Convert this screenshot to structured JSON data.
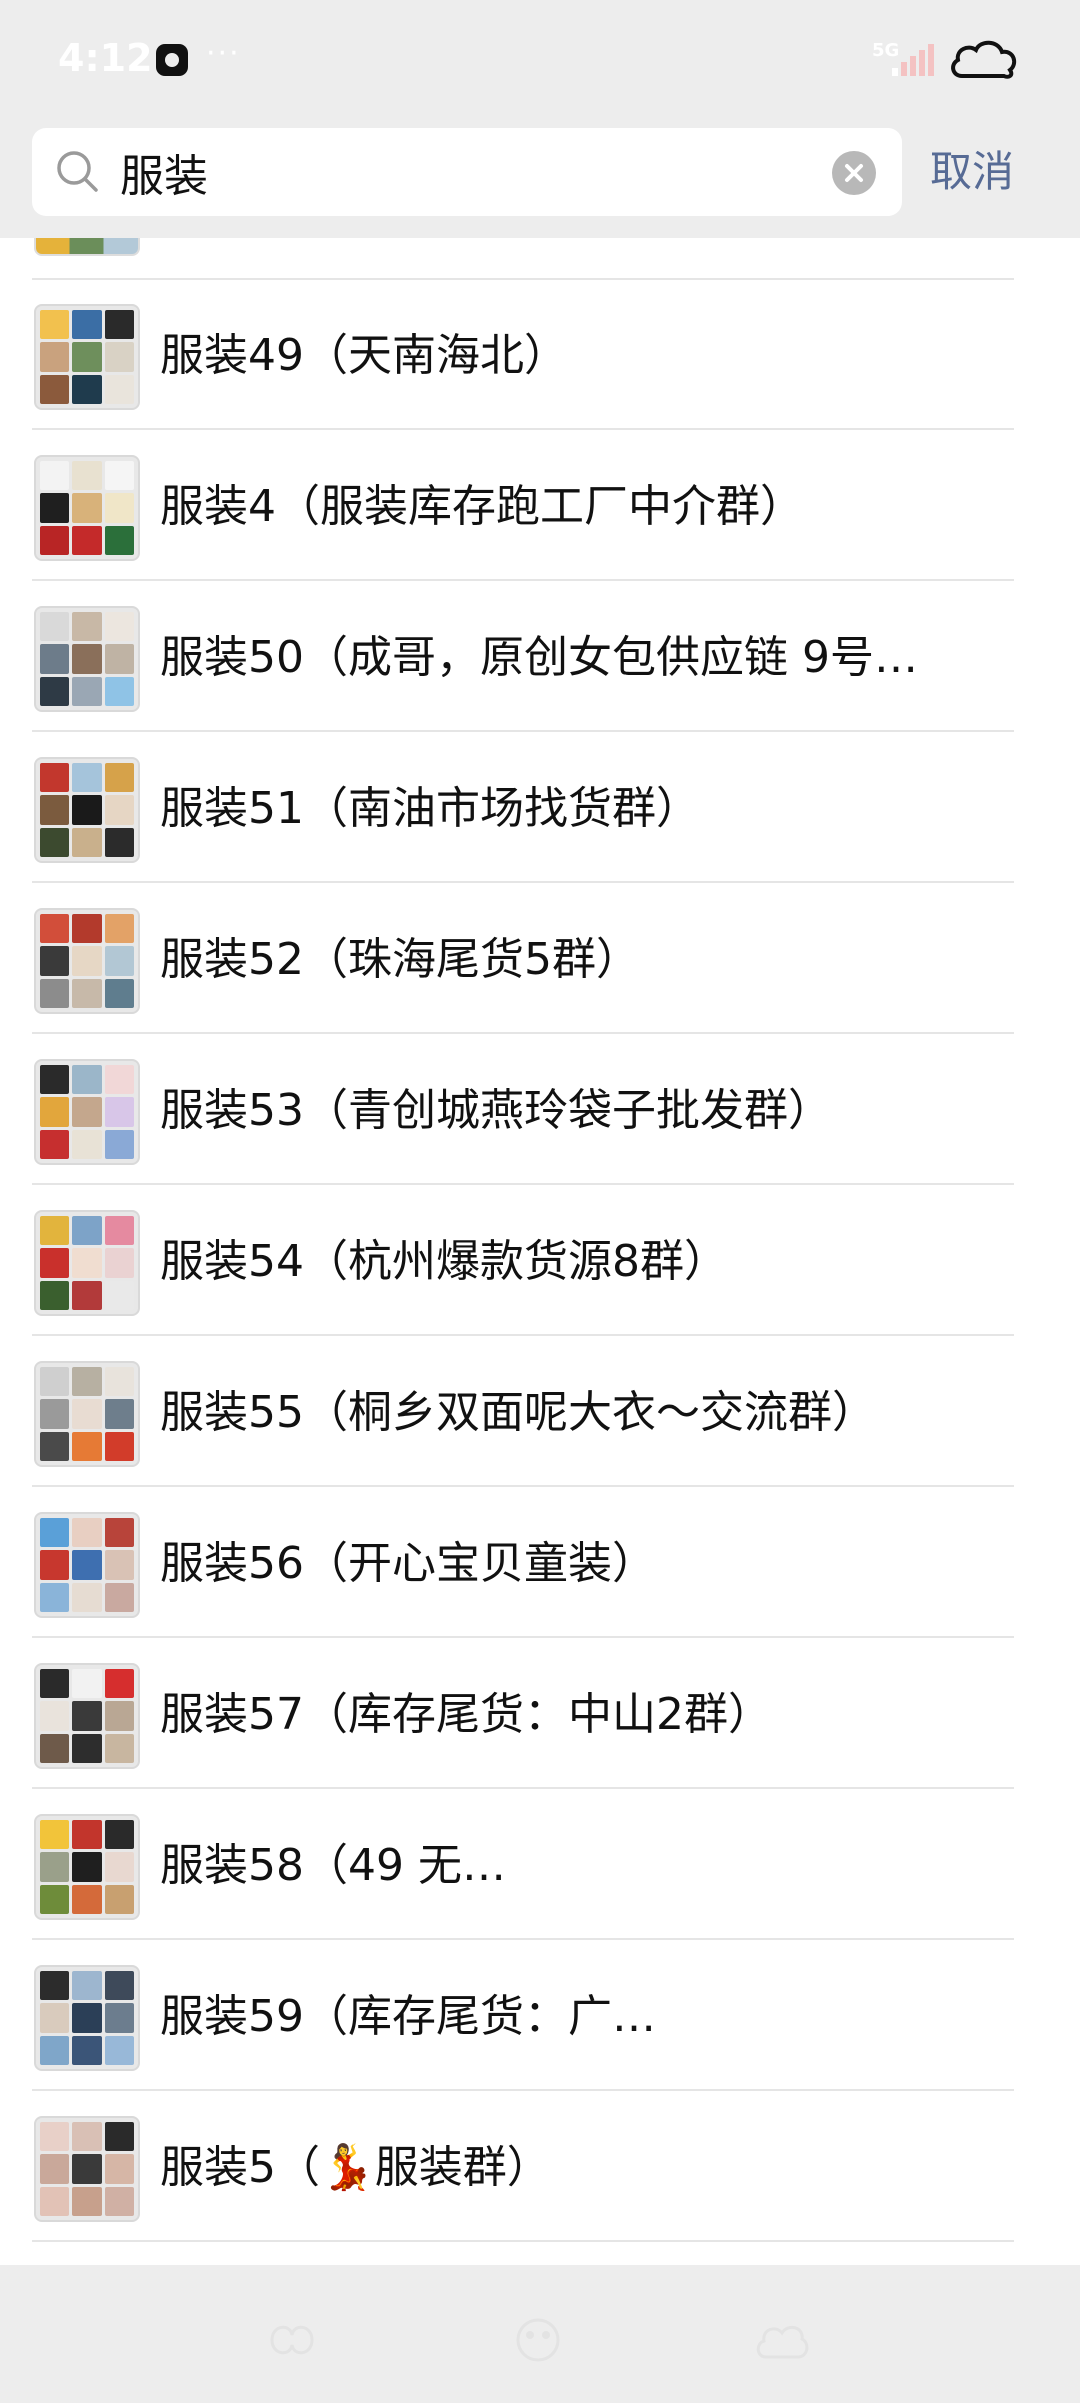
{
  "status_bar": {
    "time": "4:12",
    "dots": "···",
    "network": "5G"
  },
  "search": {
    "query": "服装",
    "cancel_label": "取消"
  },
  "results": [
    {
      "title": "服装49（天南海北）",
      "tiles": [
        "#f2c14e",
        "#3b6ea5",
        "#2a2a2a",
        "#c9a27e",
        "#6e8f5c",
        "#d9d2c5",
        "#8b5a3c",
        "#1f3b4d",
        "#e9e4dc"
      ]
    },
    {
      "title": "服装4（服装库存跑工厂中介群）",
      "tiles": [
        "#f3f3f3",
        "#e8e1d0",
        "#f5f5f5",
        "#1f1f1f",
        "#d8b27a",
        "#f0e6c8",
        "#b82525",
        "#c42a2a",
        "#2b6f3a"
      ]
    },
    {
      "title": "服装50（成哥，原创女包供应链 9号…",
      "tiles": [
        "#d9d9d9",
        "#c8b8a6",
        "#ece6df",
        "#6d7c8a",
        "#8a6f5a",
        "#bfb3a4",
        "#2e3a45",
        "#9aa7b4",
        "#8fc3e6"
      ]
    },
    {
      "title": "服装51（南油市场找货群）",
      "tiles": [
        "#c2372d",
        "#a5c4db",
        "#d6a24a",
        "#7b5b3e",
        "#1a1a1a",
        "#e6d6c4",
        "#3c4a2f",
        "#c9b08c",
        "#2b2b2b"
      ]
    },
    {
      "title": "服装52（珠海尾货5群）",
      "tiles": [
        "#d24e3a",
        "#b33a2c",
        "#e3a267",
        "#3a3a3a",
        "#e6d7c5",
        "#b2c7d4",
        "#8c8c8c",
        "#c7b9a9",
        "#5f7d8e"
      ]
    },
    {
      "title": "服装53（青创城燕玲袋子批发群）",
      "tiles": [
        "#2a2a2a",
        "#9bb6c9",
        "#f1d7d7",
        "#e2a63c",
        "#c4a78d",
        "#d8c6e8",
        "#c62f2f",
        "#e8e2d6",
        "#8aa9d6"
      ]
    },
    {
      "title": "服装54（杭州爆款货源8群）",
      "tiles": [
        "#e2b43d",
        "#7da3c8",
        "#e58aa0",
        "#c9302c",
        "#f0ddd0",
        "#ead2d2",
        "#3a5f2e",
        "#b23a3a",
        "#e9e9e9"
      ]
    },
    {
      "title": "服装55（桐乡双面呢大衣～交流群）",
      "tiles": [
        "#cfcfcf",
        "#b7b0a2",
        "#e8e3dc",
        "#9a9a9a",
        "#e8dcd2",
        "#6e7e8c",
        "#4a4a4a",
        "#e67a35",
        "#d23c2a"
      ]
    },
    {
      "title": "服装56（开心宝贝童装）",
      "tiles": [
        "#5aa0d8",
        "#e8cfc2",
        "#b8443a",
        "#c7372e",
        "#3e6fb0",
        "#d9c2b5",
        "#8ab4d9",
        "#e6dcd2",
        "#c9a9a0"
      ]
    },
    {
      "title": "服装57（库存尾货：中山2群）",
      "tiles": [
        "#2a2a2a",
        "#f2f2f2",
        "#d62e2e",
        "#e9e3dc",
        "#3a3a3a",
        "#b9a794",
        "#6e5a4a",
        "#2d2d2d",
        "#c8b6a0"
      ]
    },
    {
      "title": "服装58（49 无…",
      "tiles": [
        "#f2c43a",
        "#c2352c",
        "#2a2a2a",
        "#9aa08a",
        "#1f1f1f",
        "#e8d8d0",
        "#6e8c3a",
        "#d46a3a",
        "#c8a070"
      ]
    },
    {
      "title": "服装59（库存尾货：广…",
      "tiles": [
        "#2c2c2c",
        "#9db6cf",
        "#3e4a5a",
        "#d9cbbd",
        "#2b3f57",
        "#6c7d8e",
        "#7fa6c9",
        "#3b5578",
        "#98b8d8"
      ]
    },
    {
      "title": "服装5（💃服装群）",
      "tiles": [
        "#e8d0c8",
        "#d9c0b5",
        "#2a2a2a",
        "#c9a89a",
        "#3a3a3a",
        "#d6b6a6",
        "#e2c2b6",
        "#c7a08c",
        "#d0b0a4"
      ]
    }
  ]
}
